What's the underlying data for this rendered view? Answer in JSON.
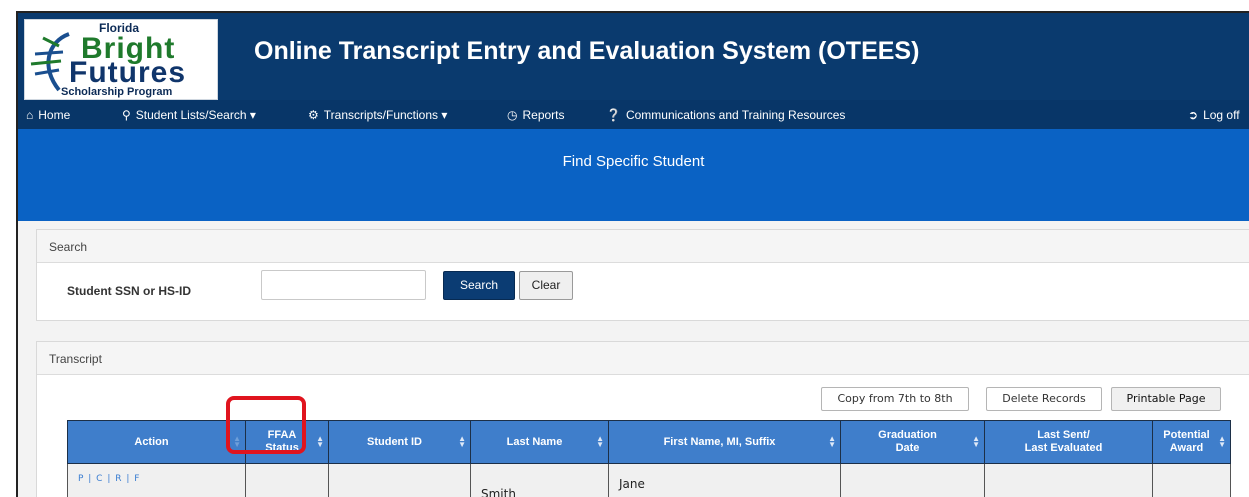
{
  "header": {
    "logo": {
      "line1": "Florida",
      "line2": "Bright",
      "line3": "Futures",
      "line4": "Scholarship Program"
    },
    "title": "Online Transcript Entry and Evaluation System (OTEES)"
  },
  "nav": {
    "items": [
      {
        "label": "Home",
        "icon": "home-icon"
      },
      {
        "label": "Student Lists/Search",
        "icon": "search-icon"
      },
      {
        "label": "Transcripts/Functions",
        "icon": "gear-icon"
      },
      {
        "label": "Reports",
        "icon": "clock-icon"
      },
      {
        "label": "Communications and Training Resources",
        "icon": "question-icon"
      }
    ],
    "logoff": "Log off"
  },
  "banner": {
    "title": "Find Specific Student"
  },
  "search": {
    "heading": "Search",
    "field_label": "Student SSN or HS-ID",
    "input_value": "",
    "search_button": "Search",
    "clear_button": "Clear"
  },
  "transcript": {
    "heading": "Transcript",
    "buttons": {
      "copy": "Copy from 7th to 8th",
      "delete": "Delete Records",
      "print": "Printable Page"
    },
    "columns": [
      {
        "l1": "Action",
        "l2": ""
      },
      {
        "l1": "FFAA",
        "l2": "Status"
      },
      {
        "l1": "Student ID",
        "l2": ""
      },
      {
        "l1": "Last Name",
        "l2": ""
      },
      {
        "l1": "First Name, MI, Suffix",
        "l2": ""
      },
      {
        "l1": "Graduation",
        "l2": "Date"
      },
      {
        "l1": "Last Sent/",
        "l2": "Last Evaluated"
      },
      {
        "l1": "Potential",
        "l2": "Award"
      }
    ],
    "rows": [
      {
        "action": "P | C | R | F",
        "ffaa_status": "",
        "student_id": "",
        "last_name": "Smith",
        "first_name": "Jane",
        "graduation_date": "",
        "last_sent": "",
        "potential_award": ""
      }
    ]
  },
  "colors": {
    "header_bg": "#0a3a6e",
    "banner_bg": "#0a62c4",
    "table_header_bg": "#3f7ecb",
    "highlight": "#e0141e"
  }
}
